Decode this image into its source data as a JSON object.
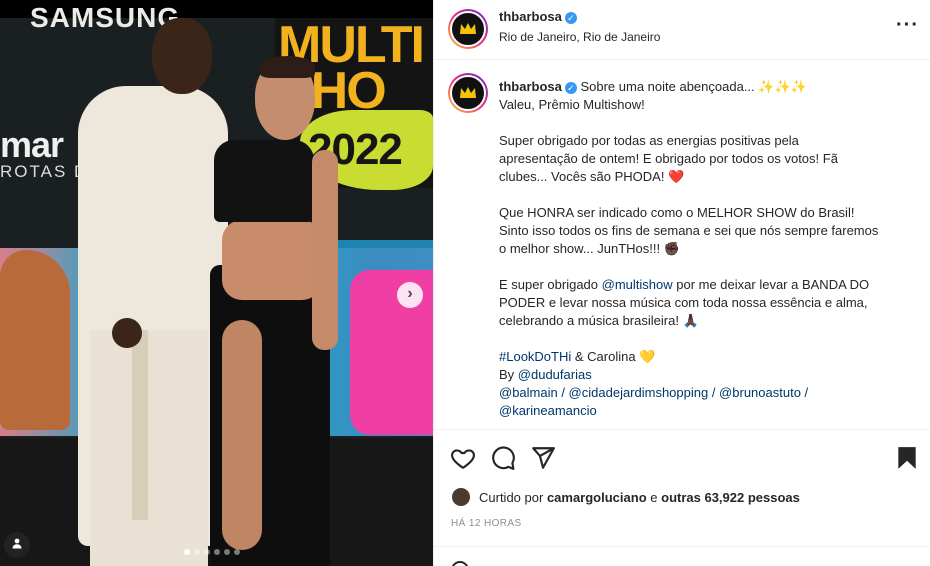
{
  "post": {
    "username": "thbarbosa",
    "location": "Rio de Janeiro, Rio de Janeiro",
    "caption_lines": [
      "Sobre uma noite abençoada... ✨✨✨",
      "Valeu, Prêmio Multishow!",
      "",
      "Super obrigado por todas as energias positivas pela",
      "apresentação de ontem! E obrigado por todos os votos! Fã",
      "clubes... Vocês são PHODA! ❤️",
      "",
      "Que HONRA ser indicado como o MELHOR SHOW do Brasil!",
      "Sinto isso todos os fins de semana e sei que nós sempre faremos",
      "o melhor show... JunTHos!!! ✊🏿",
      "",
      "E super obrigado @multishow por me deixar levar a BANDA DO",
      "PODER e levar nossa música com toda nossa essência e alma,",
      "celebrando a música brasileira! 🙏🏿",
      "",
      "#LookDoTHi & Carolina 💛",
      "By @dudufarias",
      "@balmain / @cidadejardimshopping / @brunoastuto /",
      "@karineamancio"
    ],
    "liked_by_prefix": "Curtido por",
    "liked_by_user": "camargoluciano",
    "liked_by_mid": "e",
    "liked_by_others": "outras 63,922 pessoas",
    "timestamp": "HÁ 12 HORAS"
  },
  "photo": {
    "backdrop_text_top": "SAMSUNG",
    "backdrop_text_left": "mar",
    "backdrop_text_left_sub": "ROTAS DO",
    "backdrop_text_right": "MULTI SHO",
    "backdrop_text_year": "2022",
    "carousel_total": 6,
    "carousel_index": 1
  },
  "icons": {
    "verified": "verified-badge-icon",
    "more": "more-options-icon",
    "like": "heart-icon",
    "comment": "comment-icon",
    "share": "send-icon",
    "save": "bookmark-icon",
    "next": "chevron-right-icon",
    "tag": "user-tag-icon",
    "emoji": "smile-icon"
  },
  "colors": {
    "link": "#00376b",
    "verified": "#3897f0",
    "avatar_ring": "#ee2a7b"
  }
}
